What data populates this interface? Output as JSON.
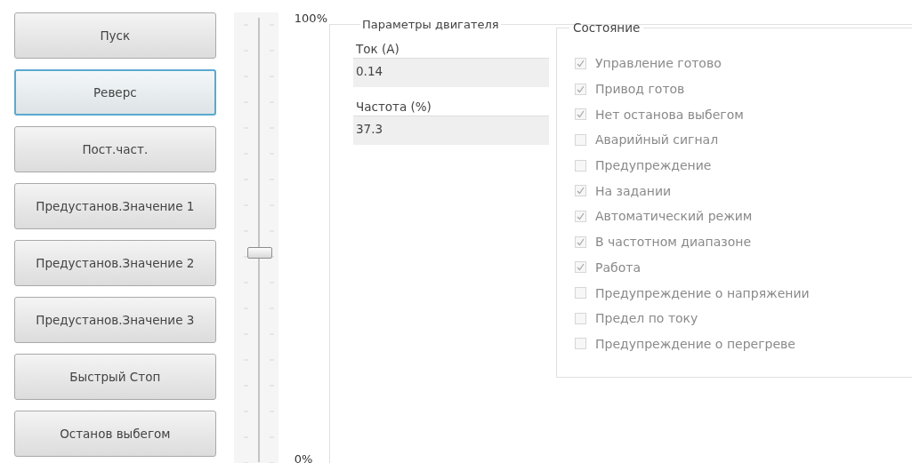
{
  "buttons": [
    {
      "label": "Пуск",
      "focused": false
    },
    {
      "label": "Реверс",
      "focused": true
    },
    {
      "label": "Пост.част.",
      "focused": false
    },
    {
      "label": "Предустанов.Значение 1",
      "focused": false
    },
    {
      "label": "Предустанов.Значение 2",
      "focused": false
    },
    {
      "label": "Предустанов.Значение 3",
      "focused": false
    },
    {
      "label": "Быстрый Стоп",
      "focused": false
    },
    {
      "label": "Останов выбегом",
      "focused": false
    }
  ],
  "slider": {
    "level": 0.48,
    "max_label": "100%",
    "min_label": "0%"
  },
  "motor_group": {
    "title": "Параметры двигателя",
    "fields": [
      {
        "label": "Ток (А)",
        "value": "0.14"
      },
      {
        "label": "Частота (%)",
        "value": "37.3"
      }
    ],
    "status": {
      "title": "Состояние",
      "items": [
        {
          "label": "Управление готово",
          "checked": true,
          "disabled": true
        },
        {
          "label": "Привод готов",
          "checked": true,
          "disabled": true
        },
        {
          "label": "Нет останова выбегом",
          "checked": true,
          "disabled": true
        },
        {
          "label": "Аварийный сигнал",
          "checked": false,
          "disabled": true
        },
        {
          "label": "Предупреждение",
          "checked": false,
          "disabled": true
        },
        {
          "label": "На задании",
          "checked": true,
          "disabled": true
        },
        {
          "label": "Автоматический режим",
          "checked": true,
          "disabled": true
        },
        {
          "label": "В частотном диапазоне",
          "checked": true,
          "disabled": true
        },
        {
          "label": "Работа",
          "checked": true,
          "disabled": true
        },
        {
          "label": "Предупреждение о напряжении",
          "checked": false,
          "disabled": true
        },
        {
          "label": "Предел по току",
          "checked": false,
          "disabled": true
        },
        {
          "label": "Предупреждение о перегреве",
          "checked": false,
          "disabled": true
        }
      ]
    }
  }
}
